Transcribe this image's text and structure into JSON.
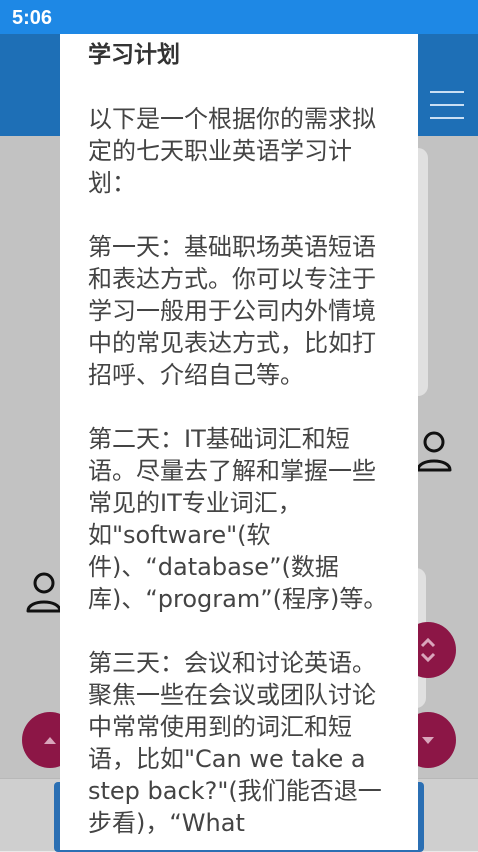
{
  "status_bar": {
    "time": "5:06"
  },
  "dialog": {
    "title": "学习计划",
    "paragraphs": [
      "以下是一个根据你的需求拟定的七天职业英语学习计划：",
      "第一天：基础职场英语短语和表达方式。你可以专注于学习一般用于公司内外情境中的常见表达方式，比如打招呼、介绍自己等。",
      "第二天：IT基础词汇和短语。尽量去了解和掌握一些常见的IT专业词汇，如\"software\"(软件)、“database”(数据库)、“program”(程序)等。",
      "第三天：会议和讨论英语。聚焦一些在会议或团队讨论中常常使用到的词汇和短语，比如\"Can we take a step back?\"(我们能否退一步看)，“What"
    ]
  },
  "icons": {
    "menu": "hamburger-menu-icon",
    "user": "user-avatar-icon",
    "scroll_both": "chevron-up-down-icon",
    "scroll_up": "arrow-up-icon",
    "scroll_down": "arrow-down-icon"
  },
  "colors": {
    "status_bar": "#1e88e5",
    "app_bar": "#1e6fb6",
    "fab": "#8c1646",
    "scrim": "#c2c2c2"
  }
}
